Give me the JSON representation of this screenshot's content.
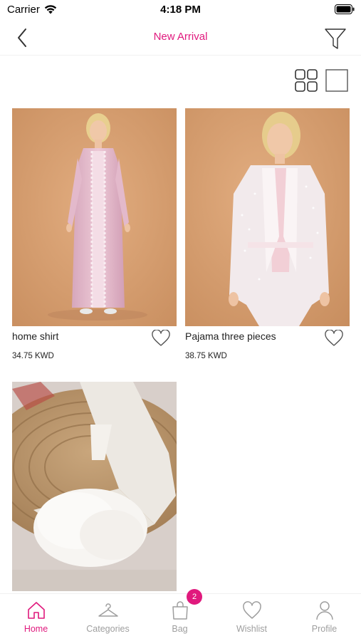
{
  "status_bar": {
    "carrier": "Carrier",
    "time": "4:18 PM"
  },
  "nav": {
    "title": "New Arrival",
    "accent_color": "#e0197d"
  },
  "products": [
    {
      "name": "home shirt",
      "price": "34.75 KWD",
      "image": "woman in long pink lace robe"
    },
    {
      "name": "Pajama three pieces",
      "price": "38.75 KWD",
      "image": "woman in white lace robe with belt"
    },
    {
      "name": "",
      "price": "",
      "image": "white feather heeled slipper on woven mat"
    }
  ],
  "tabs": [
    {
      "label": "Home",
      "icon": "home-icon",
      "active": true
    },
    {
      "label": "Categories",
      "icon": "hanger-icon",
      "active": false
    },
    {
      "label": "Bag",
      "icon": "bag-icon",
      "active": false,
      "badge": "2"
    },
    {
      "label": "Wishlist",
      "icon": "heart-icon",
      "active": false
    },
    {
      "label": "Profile",
      "icon": "user-icon",
      "active": false
    }
  ]
}
